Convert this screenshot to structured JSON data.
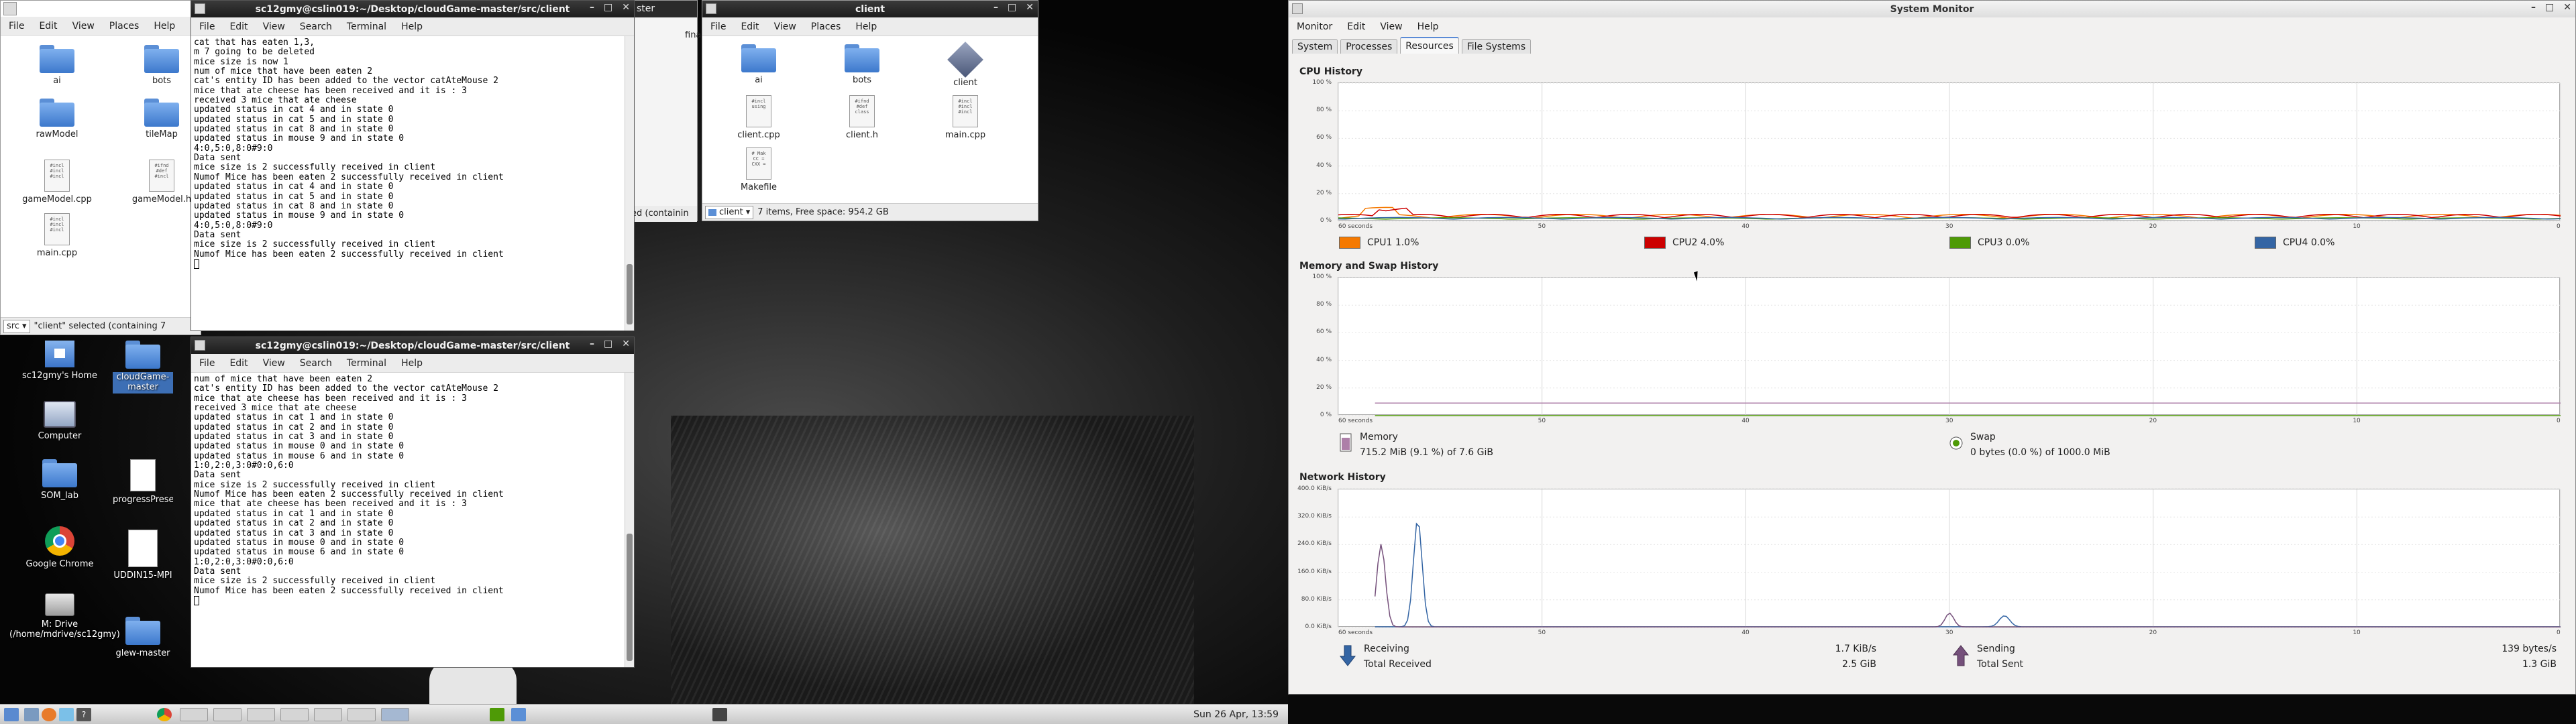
{
  "left_file_manager": {
    "menu": [
      "File",
      "Edit",
      "View",
      "Places",
      "Help"
    ],
    "icons": [
      {
        "name": "ai",
        "type": "folder"
      },
      {
        "name": "bots",
        "type": "folder"
      },
      {
        "name": "rawModel",
        "type": "folder"
      },
      {
        "name": "tileMap",
        "type": "folder"
      },
      {
        "name": "gameModel.cpp",
        "type": "cpp"
      },
      {
        "name": "gameModel.h",
        "type": "h"
      },
      {
        "name": "main.cpp",
        "type": "cpp"
      }
    ],
    "path": "src",
    "status": "\"client\" selected (containing 7"
  },
  "client_file_manager": {
    "title": "client",
    "menu": [
      "File",
      "Edit",
      "View",
      "Places",
      "Help"
    ],
    "icons": [
      {
        "name": "ai",
        "type": "folder"
      },
      {
        "name": "bots",
        "type": "folder"
      },
      {
        "name": "client",
        "type": "exec"
      },
      {
        "name": "client.cpp",
        "type": "cpp"
      },
      {
        "name": "client.h",
        "type": "h"
      },
      {
        "name": "main.cpp",
        "type": "cpp"
      },
      {
        "name": "Makefile",
        "type": "make"
      }
    ],
    "path": "client",
    "status": "7 items, Free space: 954.2 GB"
  },
  "hidden_window": {
    "title_fragment": "ster",
    "side_text": "fina",
    "status_fragment": "ed (containin"
  },
  "terminal_top": {
    "title": "sc12gmy@cslin019:~/Desktop/cloudGame-master/src/client",
    "menu": [
      "File",
      "Edit",
      "View",
      "Search",
      "Terminal",
      "Help"
    ],
    "lines": [
      "cat that has eaten 1,3,",
      "m 7 going to be deleted",
      "mice size is now 1",
      "num of mice that have been eaten 2",
      "cat's entity ID has been added to the vector catAteMouse 2",
      "mice that ate cheese has been received and it is : 3",
      "received 3 mice that ate cheese",
      "updated status in cat 4 and in state 0",
      "updated status in cat 5 and in state 0",
      "updated status in cat 8 and in state 0",
      "updated status in mouse 9 and in state 0",
      "4:0,5:0,8:0#9:0",
      "Data sent",
      "mice size is 2 successfully received in client",
      "Numof Mice has been eaten 2 successfully received in client",
      "updated status in cat 4 and in state 0",
      "updated status in cat 5 and in state 0",
      "updated status in cat 8 and in state 0",
      "updated status in mouse 9 and in state 0",
      "4:0,5:0,8:0#9:0",
      "Data sent",
      "mice size is 2 successfully received in client",
      "Numof Mice has been eaten 2 successfully received in client"
    ]
  },
  "terminal_bottom": {
    "title": "sc12gmy@cslin019:~/Desktop/cloudGame-master/src/client",
    "menu": [
      "File",
      "Edit",
      "View",
      "Search",
      "Terminal",
      "Help"
    ],
    "lines": [
      "num of mice that have been eaten 2",
      "cat's entity ID has been added to the vector catAteMouse 2",
      "mice that ate cheese has been received and it is : 3",
      "received 3 mice that ate cheese",
      "updated status in cat 1 and in state 0",
      "updated status in cat 2 and in state 0",
      "updated status in cat 3 and in state 0",
      "updated status in mouse 0 and in state 0",
      "updated status in mouse 6 and in state 0",
      "1:0,2:0,3:0#0:0,6:0",
      "Data sent",
      "mice size is 2 successfully received in client",
      "Numof Mice has been eaten 2 successfully received in client",
      "mice that ate cheese has been received and it is : 3",
      "updated status in cat 1 and in state 0",
      "updated status in cat 2 and in state 0",
      "updated status in cat 3 and in state 0",
      "updated status in mouse 0 and in state 0",
      "updated status in mouse 6 and in state 0",
      "1:0,2:0,3:0#0:0,6:0",
      "Data sent",
      "mice size is 2 successfully received in client",
      "Numof Mice has been eaten 2 successfully received in client"
    ]
  },
  "desktop_icons": [
    {
      "label": "sc12gmy's Home",
      "kind": "home"
    },
    {
      "label": "cloudGame-master",
      "kind": "folder",
      "selected": true
    },
    {
      "label": "Computer",
      "kind": "computer"
    },
    {
      "label": "SOM_lab",
      "kind": "folder"
    },
    {
      "label": "progressPresentation.ppt",
      "kind": "doc"
    },
    {
      "label": "Google Chrome",
      "kind": "chrome"
    },
    {
      "label": "UDDIN15-MPI",
      "kind": "doc"
    },
    {
      "label": "M: Drive (/home/mdrive/sc12gmy)",
      "kind": "drive"
    },
    {
      "label": "glew-master",
      "kind": "folder"
    }
  ],
  "taskbar": {
    "clock": "Sun 26 Apr, 13:59"
  },
  "system_monitor": {
    "title": "System Monitor",
    "menu": [
      "Monitor",
      "Edit",
      "View",
      "Help"
    ],
    "tabs": [
      "System",
      "Processes",
      "Resources",
      "File Systems"
    ],
    "active_tab": "Resources",
    "cpu": {
      "title": "CPU History",
      "yticks": [
        "100 %",
        "80 %",
        "60 %",
        "40 %",
        "20 %",
        "0 %"
      ],
      "xticks": [
        "60 seconds",
        "50",
        "40",
        "30",
        "20",
        "10",
        "0"
      ],
      "legend": [
        {
          "label": "CPU1 1.0%",
          "color": "#f57900"
        },
        {
          "label": "CPU2 4.0%",
          "color": "#cc0000"
        },
        {
          "label": "CPU3 0.0%",
          "color": "#4e9a06"
        },
        {
          "label": "CPU4 0.0%",
          "color": "#3465a4"
        }
      ]
    },
    "memory": {
      "title": "Memory and Swap History",
      "yticks": [
        "100 %",
        "80 %",
        "60 %",
        "40 %",
        "20 %",
        "0 %"
      ],
      "xticks": [
        "60 seconds",
        "50",
        "40",
        "30",
        "20",
        "10",
        "0"
      ],
      "memory_label": "Memory",
      "memory_value": "715.2 MiB (9.1 %) of 7.6 GiB",
      "memory_color": "#ad7fa8",
      "swap_label": "Swap",
      "swap_value": "0 bytes (0.0 %) of 1000.0 MiB",
      "swap_color": "#4e9a06"
    },
    "network": {
      "title": "Network History",
      "yticks": [
        "400.0 KiB/s",
        "320.0 KiB/s",
        "240.0 KiB/s",
        "160.0 KiB/s",
        "80.0 KiB/s",
        "0.0 KiB/s"
      ],
      "xticks": [
        "60 seconds",
        "50",
        "40",
        "30",
        "20",
        "10",
        "0"
      ],
      "receiving_label": "Receiving",
      "receiving_value": "1.7 KiB/s",
      "total_received_label": "Total Received",
      "total_received_value": "2.5 GiB",
      "sending_label": "Sending",
      "sending_value": "139 bytes/s",
      "total_sent_label": "Total Sent",
      "total_sent_value": "1.3 GiB",
      "receive_color": "#3465a4",
      "send_color": "#75507b"
    }
  }
}
